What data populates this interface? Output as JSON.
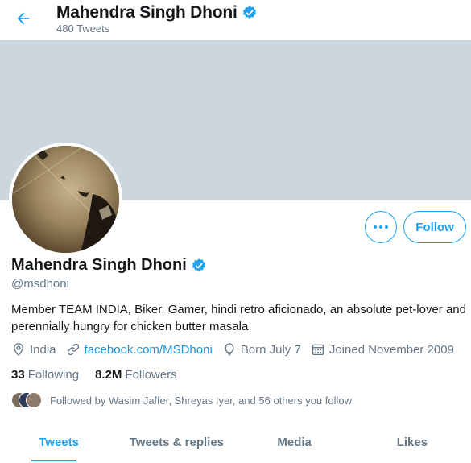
{
  "header": {
    "back_icon": "arrow-left-icon",
    "name": "Mahendra Singh Dhoni",
    "tweet_count": "480 Tweets"
  },
  "profile": {
    "name": "Mahendra Singh Dhoni",
    "handle": "@msdhoni",
    "verified_icon": "verified-badge-icon",
    "bio": "Member TEAM INDIA, Biker, Gamer, hindi retro aficionado, an absolute pet-lover and perennially hungry for chicken butter masala",
    "location": "India",
    "website": "facebook.com/MSDhoni",
    "birthday": "Born July 7",
    "joined": "Joined November 2009",
    "following_count": "33",
    "following_label": "Following",
    "followers_count": "8.2M",
    "followers_label": "Followers",
    "followed_by": "Followed by Wasim Jaffer, Shreyas Iyer, and 56 others you follow"
  },
  "actions": {
    "more_icon": "more-horizontal-icon",
    "follow_label": "Follow"
  },
  "tabs": [
    {
      "label": "Tweets",
      "active": true
    },
    {
      "label": "Tweets & replies",
      "active": false
    },
    {
      "label": "Media",
      "active": false
    },
    {
      "label": "Likes",
      "active": false
    }
  ],
  "colors": {
    "accent": "#1da1f2",
    "banner": "#ccd6dd",
    "secondary_text": "#657786",
    "primary_text": "#14171a"
  }
}
